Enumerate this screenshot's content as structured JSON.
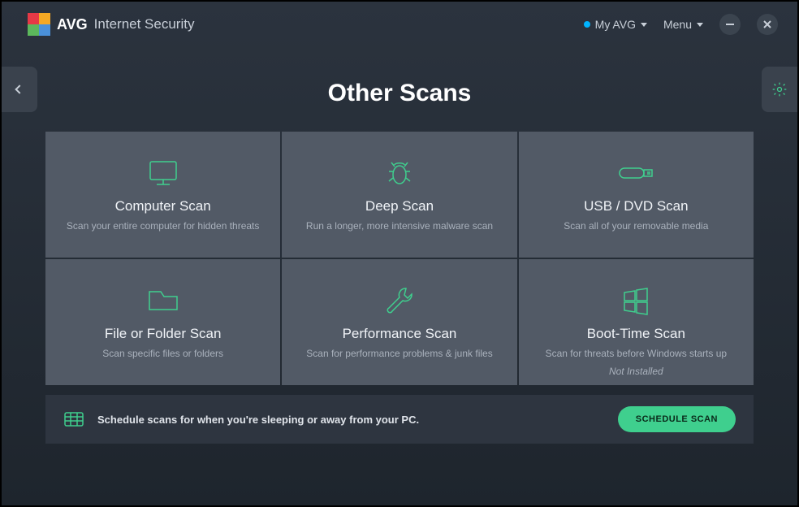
{
  "header": {
    "brand": "AVG",
    "product": "Internet Security",
    "my_avg": "My AVG",
    "menu": "Menu"
  },
  "page": {
    "title": "Other Scans"
  },
  "tiles": [
    {
      "title": "Computer Scan",
      "desc": "Scan your entire computer for hidden threats"
    },
    {
      "title": "Deep Scan",
      "desc": "Run a longer, more intensive malware scan"
    },
    {
      "title": "USB / DVD Scan",
      "desc": "Scan all of your removable media"
    },
    {
      "title": "File or Folder Scan",
      "desc": "Scan specific files or folders"
    },
    {
      "title": "Performance Scan",
      "desc": "Scan for performance problems & junk files"
    },
    {
      "title": "Boot-Time Scan",
      "desc": "Scan for threats before Windows starts up",
      "badge": "Not Installed"
    }
  ],
  "footer": {
    "text": "Schedule scans for when you're sleeping or away from your PC.",
    "button": "SCHEDULE SCAN"
  }
}
